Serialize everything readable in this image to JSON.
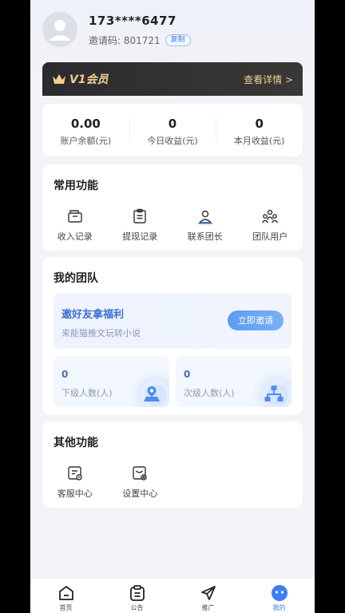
{
  "user": {
    "phone": "173****6477",
    "invite_label": "邀请码: 801721",
    "copy_label": "复制"
  },
  "vip": {
    "title": "V1会员",
    "detail_label": "查看详情 >"
  },
  "stats": [
    {
      "value": "0.00",
      "label": "账户余额(元)"
    },
    {
      "value": "0",
      "label": "今日收益(元)"
    },
    {
      "value": "0",
      "label": "本月收益(元)"
    }
  ],
  "common": {
    "title": "常用功能",
    "items": [
      {
        "label": "收入记录",
        "icon": "wallet-icon"
      },
      {
        "label": "提现记录",
        "icon": "clipboard-icon"
      },
      {
        "label": "联系团长",
        "icon": "person-badge-icon"
      },
      {
        "label": "团队用户",
        "icon": "group-icon"
      }
    ]
  },
  "team": {
    "title": "我的团队",
    "banner_title": "邀好友拿福利",
    "banner_sub": "来能猫推文玩转小说",
    "invite_btn": "立即邀请",
    "boxes": [
      {
        "value": "0",
        "label": "下级人数(人)",
        "icon": "person-pin-icon"
      },
      {
        "value": "0",
        "label": "次级人数(人)",
        "icon": "hierarchy-icon"
      }
    ]
  },
  "other": {
    "title": "其他功能",
    "items": [
      {
        "label": "客服中心",
        "icon": "service-icon"
      },
      {
        "label": "设置中心",
        "icon": "settings-icon"
      }
    ]
  },
  "tabs": [
    {
      "label": "首页",
      "icon": "home-icon"
    },
    {
      "label": "公告",
      "icon": "notice-icon"
    },
    {
      "label": "推广",
      "icon": "send-icon"
    },
    {
      "label": "我的",
      "icon": "profile-icon",
      "active": true
    }
  ],
  "colors": {
    "accent": "#3d7ef5",
    "gold": "#f1cf91",
    "vip_bg": "#2b2b2f"
  }
}
